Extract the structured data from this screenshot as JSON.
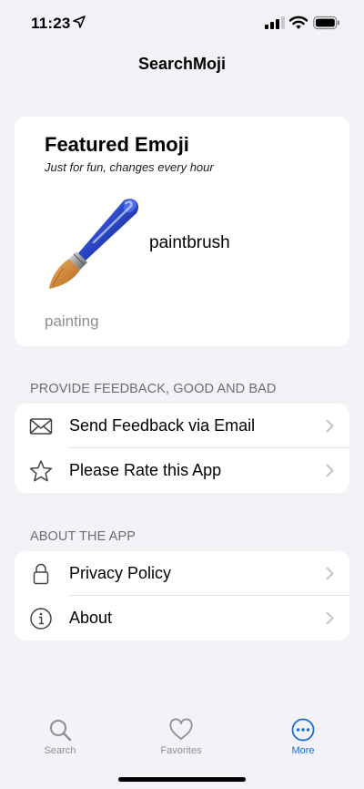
{
  "status_bar": {
    "time": "11:23"
  },
  "nav": {
    "title": "SearchMoji"
  },
  "featured": {
    "heading": "Featured Emoji",
    "subtitle": "Just for fun, changes every hour",
    "emoji_name": "paintbrush",
    "category": "painting",
    "emoji_icon": "paintbrush-icon"
  },
  "feedback_section": {
    "header": "PROVIDE FEEDBACK, GOOD AND BAD",
    "items": [
      {
        "label": "Send Feedback via Email",
        "icon": "envelope-icon"
      },
      {
        "label": "Please Rate this App",
        "icon": "star-icon"
      }
    ]
  },
  "about_section": {
    "header": "ABOUT THE APP",
    "items": [
      {
        "label": "Privacy Policy",
        "icon": "lock-icon"
      },
      {
        "label": "About",
        "icon": "info-icon"
      }
    ]
  },
  "tabs": [
    {
      "label": "Search",
      "icon": "search-icon"
    },
    {
      "label": "Favorites",
      "icon": "heart-icon"
    },
    {
      "label": "More",
      "icon": "ellipsis-circle-icon",
      "active": true
    }
  ],
  "colors": {
    "accent": "#1a6ed8",
    "background": "#f2f2f7",
    "card": "#ffffff",
    "secondary_text": "#8e8e93"
  }
}
